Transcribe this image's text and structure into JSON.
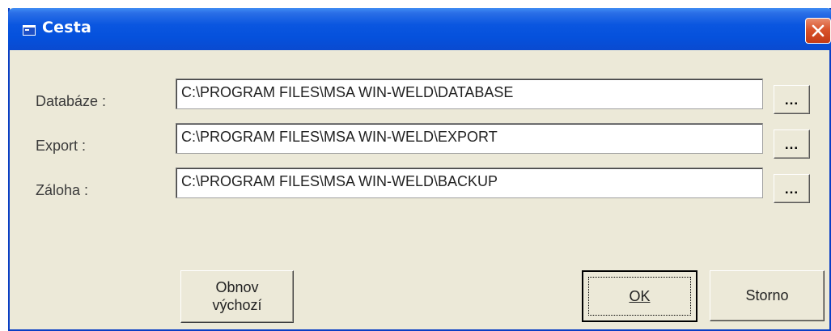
{
  "window": {
    "title": "Cesta"
  },
  "icons": {
    "title": "window-app-icon",
    "close": "close-icon"
  },
  "colors": {
    "titlebar": "#0551dc",
    "close": "#d9542b",
    "face": "#ece9d8"
  },
  "paths": [
    {
      "label": "Databáze :",
      "value": "C:\\PROGRAM FILES\\MSA WIN-WELD\\DATABASE",
      "browse": "..."
    },
    {
      "label": "Export :",
      "value": "C:\\PROGRAM FILES\\MSA WIN-WELD\\EXPORT",
      "browse": "..."
    },
    {
      "label": "Záloha :",
      "value": "C:\\PROGRAM FILES\\MSA WIN-WELD\\BACKUP",
      "browse": "..."
    }
  ],
  "buttons": {
    "reset_line1": "Obnov",
    "reset_line2": "výchozí",
    "ok": "OK",
    "cancel": "Storno"
  }
}
